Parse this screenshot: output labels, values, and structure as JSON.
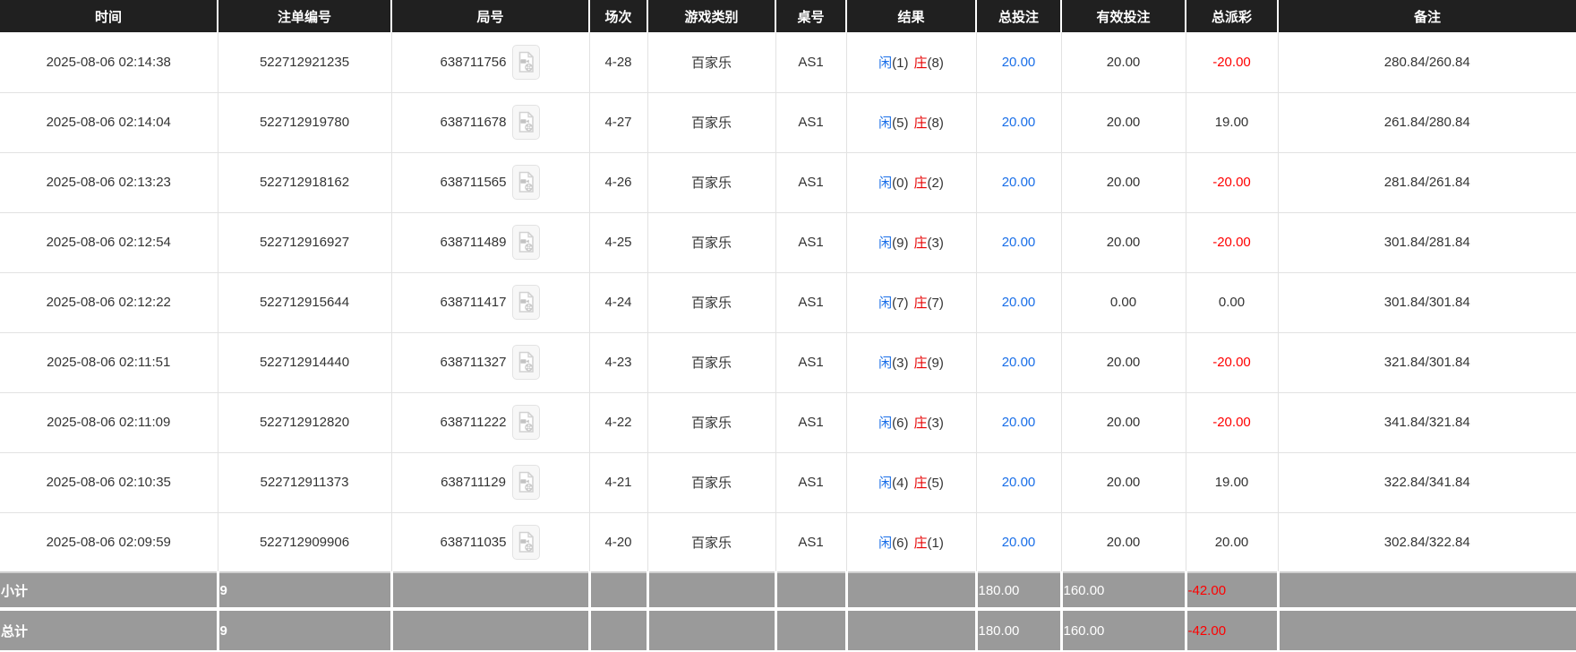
{
  "header": {
    "columns": [
      "时间",
      "注单编号",
      "局号",
      "场次",
      "游戏类别",
      "桌号",
      "结果",
      "总投注",
      "有效投注",
      "总派彩",
      "备注"
    ]
  },
  "rows": [
    {
      "time": "2025-08-06 02:14:38",
      "bet_no": "522712921235",
      "round_no": "638711756",
      "session": "4-28",
      "game_type": "百家乐",
      "table_no": "AS1",
      "result": {
        "player": "闲",
        "player_score": "(1)",
        "banker": "庄",
        "banker_score": "(8)"
      },
      "total_bet": "20.00",
      "valid_bet": "20.00",
      "total_payout": "-20.00",
      "remark": "280.84/260.84"
    },
    {
      "time": "2025-08-06 02:14:04",
      "bet_no": "522712919780",
      "round_no": "638711678",
      "session": "4-27",
      "game_type": "百家乐",
      "table_no": "AS1",
      "result": {
        "player": "闲",
        "player_score": "(5)",
        "banker": "庄",
        "banker_score": "(8)"
      },
      "total_bet": "20.00",
      "valid_bet": "20.00",
      "total_payout": "19.00",
      "remark": "261.84/280.84"
    },
    {
      "time": "2025-08-06 02:13:23",
      "bet_no": "522712918162",
      "round_no": "638711565",
      "session": "4-26",
      "game_type": "百家乐",
      "table_no": "AS1",
      "result": {
        "player": "闲",
        "player_score": "(0)",
        "banker": "庄",
        "banker_score": "(2)"
      },
      "total_bet": "20.00",
      "valid_bet": "20.00",
      "total_payout": "-20.00",
      "remark": "281.84/261.84"
    },
    {
      "time": "2025-08-06 02:12:54",
      "bet_no": "522712916927",
      "round_no": "638711489",
      "session": "4-25",
      "game_type": "百家乐",
      "table_no": "AS1",
      "result": {
        "player": "闲",
        "player_score": "(9)",
        "banker": "庄",
        "banker_score": "(3)"
      },
      "total_bet": "20.00",
      "valid_bet": "20.00",
      "total_payout": "-20.00",
      "remark": "301.84/281.84"
    },
    {
      "time": "2025-08-06 02:12:22",
      "bet_no": "522712915644",
      "round_no": "638711417",
      "session": "4-24",
      "game_type": "百家乐",
      "table_no": "AS1",
      "result": {
        "player": "闲",
        "player_score": "(7)",
        "banker": "庄",
        "banker_score": "(7)"
      },
      "total_bet": "20.00",
      "valid_bet": "0.00",
      "total_payout": "0.00",
      "remark": "301.84/301.84"
    },
    {
      "time": "2025-08-06 02:11:51",
      "bet_no": "522712914440",
      "round_no": "638711327",
      "session": "4-23",
      "game_type": "百家乐",
      "table_no": "AS1",
      "result": {
        "player": "闲",
        "player_score": "(3)",
        "banker": "庄",
        "banker_score": "(9)"
      },
      "total_bet": "20.00",
      "valid_bet": "20.00",
      "total_payout": "-20.00",
      "remark": "321.84/301.84"
    },
    {
      "time": "2025-08-06 02:11:09",
      "bet_no": "522712912820",
      "round_no": "638711222",
      "session": "4-22",
      "game_type": "百家乐",
      "table_no": "AS1",
      "result": {
        "player": "闲",
        "player_score": "(6)",
        "banker": "庄",
        "banker_score": "(3)"
      },
      "total_bet": "20.00",
      "valid_bet": "20.00",
      "total_payout": "-20.00",
      "remark": "341.84/321.84"
    },
    {
      "time": "2025-08-06 02:10:35",
      "bet_no": "522712911373",
      "round_no": "638711129",
      "session": "4-21",
      "game_type": "百家乐",
      "table_no": "AS1",
      "result": {
        "player": "闲",
        "player_score": "(4)",
        "banker": "庄",
        "banker_score": "(5)"
      },
      "total_bet": "20.00",
      "valid_bet": "20.00",
      "total_payout": "19.00",
      "remark": "322.84/341.84"
    },
    {
      "time": "2025-08-06 02:09:59",
      "bet_no": "522712909906",
      "round_no": "638711035",
      "session": "4-20",
      "game_type": "百家乐",
      "table_no": "AS1",
      "result": {
        "player": "闲",
        "player_score": "(6)",
        "banker": "庄",
        "banker_score": "(1)"
      },
      "total_bet": "20.00",
      "valid_bet": "20.00",
      "total_payout": "20.00",
      "remark": "302.84/322.84"
    }
  ],
  "summary": {
    "subtotal": {
      "label": "小计",
      "count": "9",
      "total_bet": "180.00",
      "valid_bet": "160.00",
      "total_payout": "-42.00"
    },
    "total": {
      "label": "总计",
      "count": "9",
      "total_bet": "180.00",
      "valid_bet": "160.00",
      "total_payout": "-42.00"
    }
  },
  "icons": {
    "video_icon": "video-replay-icon"
  },
  "colors": {
    "header_bg": "#202020",
    "header_text": "#ffffff",
    "row_text": "#333333",
    "player_blue": "#1a6fe8",
    "banker_red": "#e60000",
    "amount_blue": "#1a6fe8",
    "negative_red": "#ff0000",
    "summary_bg": "#9a9a9a",
    "summary_text": "#ffffff",
    "row_border": "#e2e2e2"
  }
}
